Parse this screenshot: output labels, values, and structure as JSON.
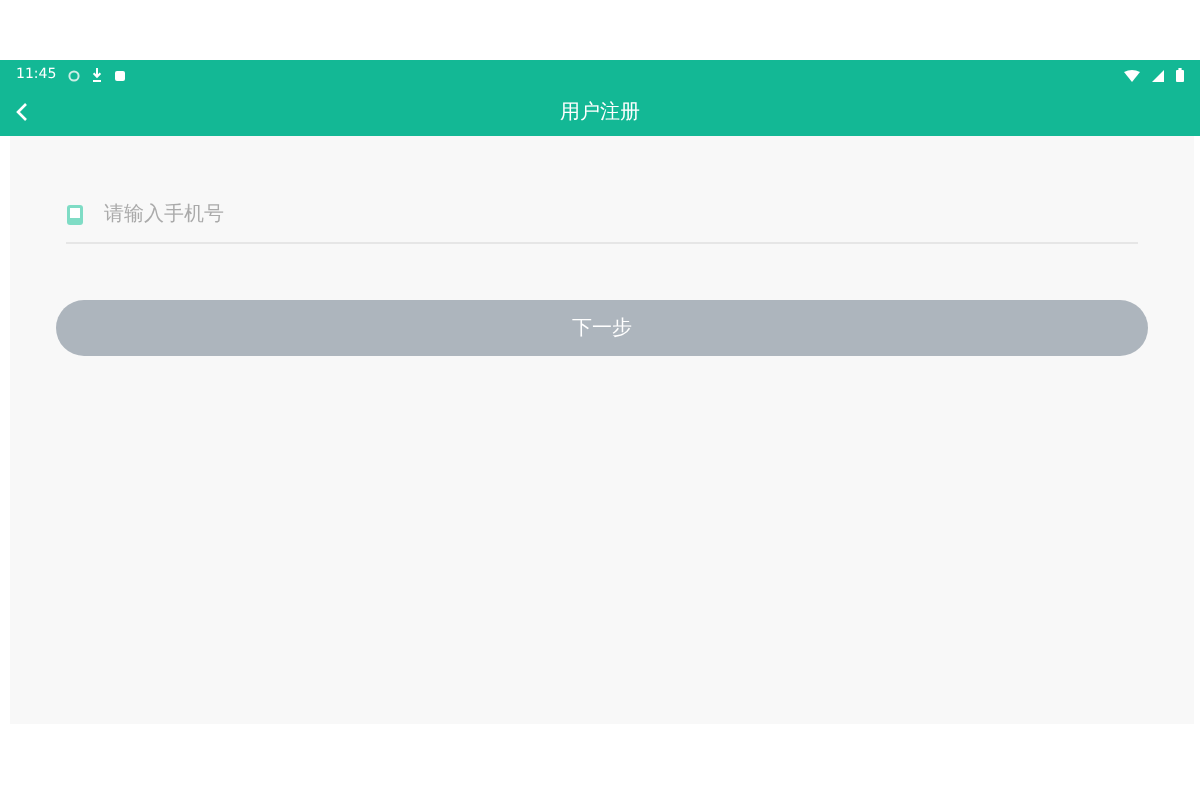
{
  "status_bar": {
    "time": "11:45"
  },
  "toolbar": {
    "title": "用户注册"
  },
  "phone_field": {
    "placeholder": "请输入手机号"
  },
  "next_button": {
    "label": "下一步",
    "disabled": true
  }
}
